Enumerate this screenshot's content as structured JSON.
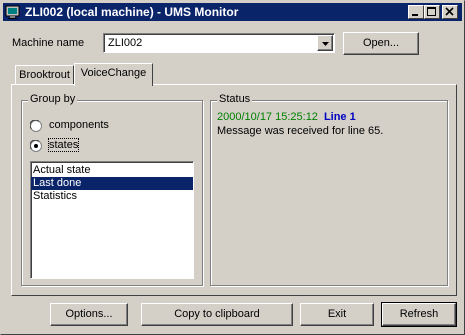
{
  "window": {
    "title": "ZLI002 (local machine) - UMS Monitor",
    "controls": [
      "minimize-icon",
      "maximize-icon",
      "close-icon"
    ]
  },
  "machine": {
    "label": "Machine name",
    "value": "ZLI002",
    "open_button": "Open..."
  },
  "tabs": [
    {
      "label": "Brooktrout",
      "active": false
    },
    {
      "label": "VoiceChange",
      "active": true
    }
  ],
  "group_by": {
    "title": "Group by",
    "options": [
      {
        "label": "components",
        "checked": false
      },
      {
        "label": "states",
        "checked": true
      }
    ],
    "list": [
      {
        "label": "Actual state",
        "selected": false
      },
      {
        "label": "Last done",
        "selected": true
      },
      {
        "label": "Statistics",
        "selected": false
      }
    ]
  },
  "status": {
    "title": "Status",
    "timestamp": "2000/10/17 15:25:12",
    "line": "Line 1",
    "message": "Message was received for line 65."
  },
  "buttons": {
    "options": "Options...",
    "copy": "Copy to clipboard",
    "exit": "Exit",
    "refresh": "Refresh"
  },
  "colors": {
    "titlebar": "#0a246a",
    "face": "#d4d0c8",
    "selection": "#0a246a",
    "timestamp": "#008000",
    "line": "#0000c0"
  }
}
